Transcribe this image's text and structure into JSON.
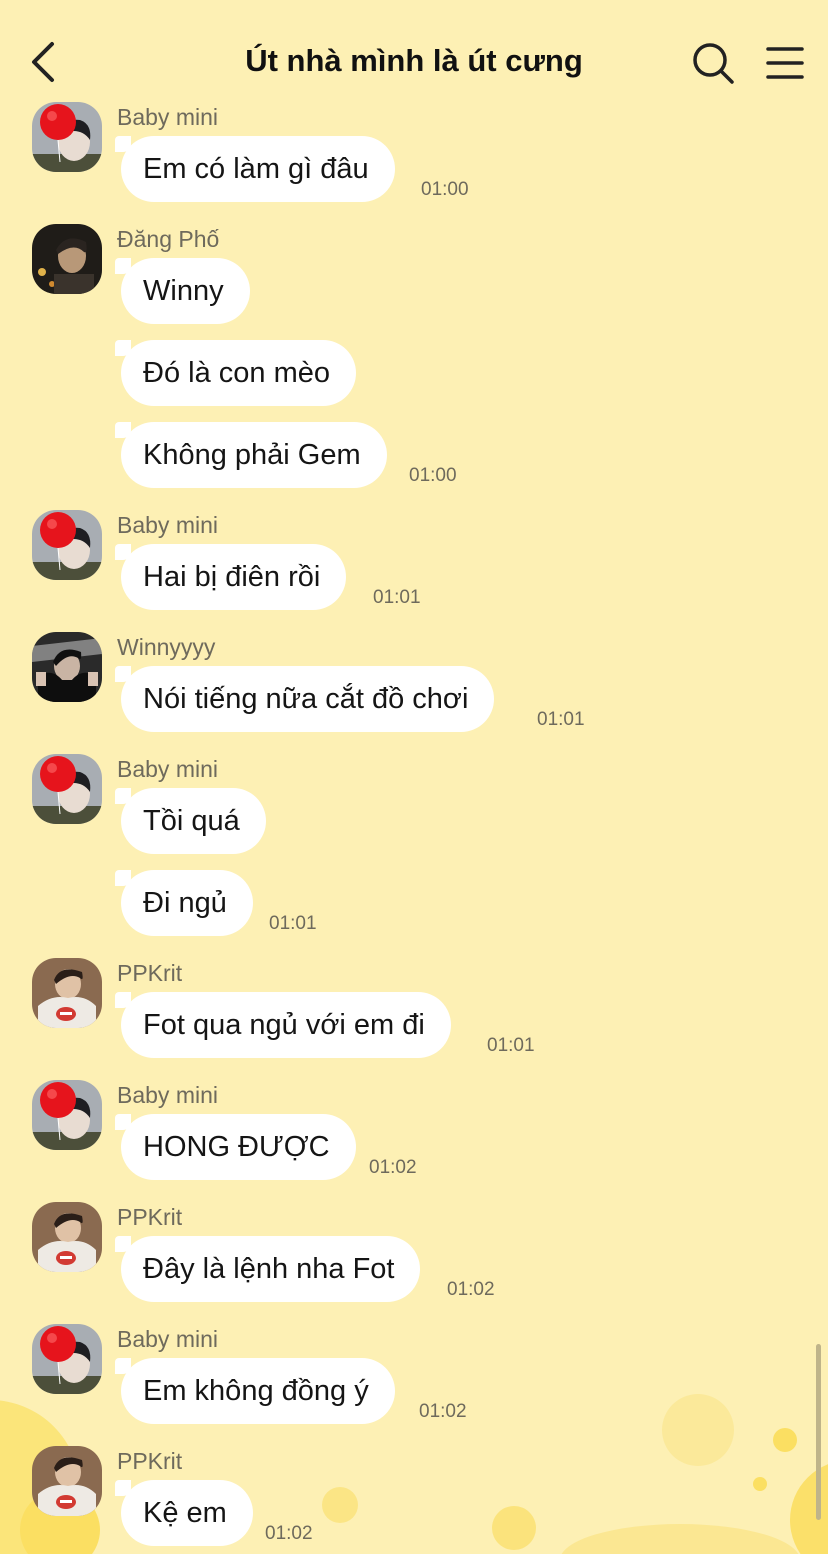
{
  "header": {
    "title": "Út nhà mình là út cưng",
    "back_icon": "chevron-left-icon",
    "search_icon": "search-icon",
    "menu_icon": "hamburger-menu-icon"
  },
  "messages": [
    {
      "sender": "Baby mini",
      "texts": [
        "Em có làm gì đâu"
      ],
      "time": "01:00"
    },
    {
      "sender": "Đăng Phố",
      "texts": [
        "Winny",
        "Đó là con mèo",
        "Không phải Gem"
      ],
      "time": "01:00"
    },
    {
      "sender": "Baby mini",
      "texts": [
        "Hai bị điên rồi"
      ],
      "time": "01:01"
    },
    {
      "sender": "Winnyyyy",
      "texts": [
        "Nói tiếng nữa cắt đồ chơi"
      ],
      "time": "01:01"
    },
    {
      "sender": "Baby mini",
      "texts": [
        "Tồi quá",
        "Đi ngủ"
      ],
      "time": "01:01"
    },
    {
      "sender": "PPKrit",
      "texts": [
        "Fot qua ngủ với em đi"
      ],
      "time": "01:01"
    },
    {
      "sender": "Baby mini",
      "texts": [
        "HONG ĐƯỢC"
      ],
      "time": "01:02"
    },
    {
      "sender": "PPKrit",
      "texts": [
        "Đây là lệnh nha Fot"
      ],
      "time": "01:02"
    },
    {
      "sender": "Baby mini",
      "texts": [
        "Em không đồng ý"
      ],
      "time": "01:02"
    },
    {
      "sender": "PPKrit",
      "texts": [
        "Kệ em"
      ],
      "time": "01:02"
    }
  ],
  "colors": {
    "background": "#fdf0b4",
    "bubble": "#ffffff",
    "meta_text": "#6e6a5c"
  }
}
